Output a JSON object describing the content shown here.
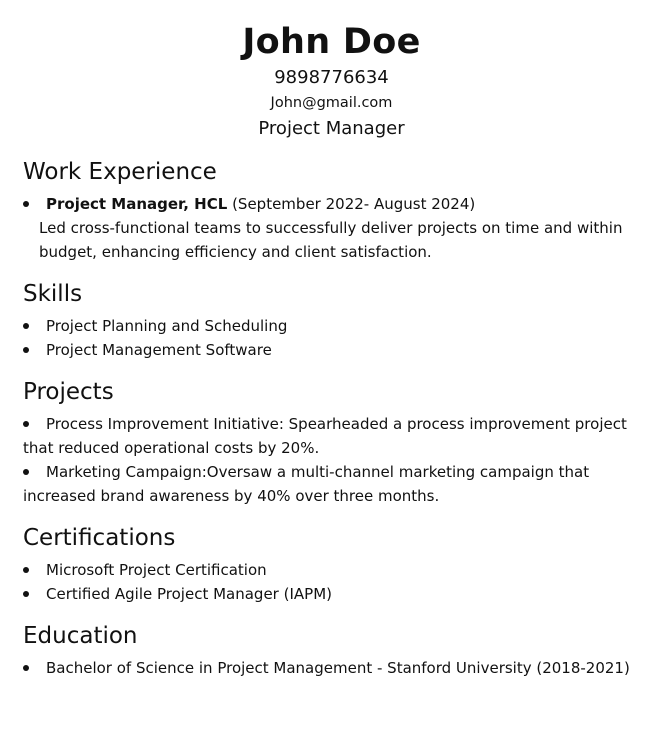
{
  "header": {
    "name": "John Doe",
    "phone": "9898776634",
    "email": "John@gmail.com",
    "role": "Project Manager"
  },
  "work": {
    "title": "Work Experience",
    "items": [
      {
        "position": "Project Manager, HCL",
        "dates": "(September 2022- August 2024)",
        "description": "Led cross-functional teams to successfully deliver projects on time and within budget, enhancing efficiency and client satisfaction."
      }
    ]
  },
  "skills": {
    "title": "Skills",
    "items": [
      "Project Planning and Scheduling",
      "Project Management Software"
    ]
  },
  "projects": {
    "title": "Projects",
    "items": [
      "Process Improvement Initiative: Spearheaded a process improvement project that reduced operational costs by 20%.",
      "Marketing Campaign:Oversaw a multi-channel marketing campaign that increased brand awareness by 40% over three months."
    ]
  },
  "certifications": {
    "title": "Certifications",
    "items": [
      "Microsoft Project Certification",
      "Certified Agile Project Manager (IAPM)"
    ]
  },
  "education": {
    "title": "Education",
    "items": [
      "Bachelor of Science in Project Management - Stanford University (2018-2021)"
    ]
  }
}
